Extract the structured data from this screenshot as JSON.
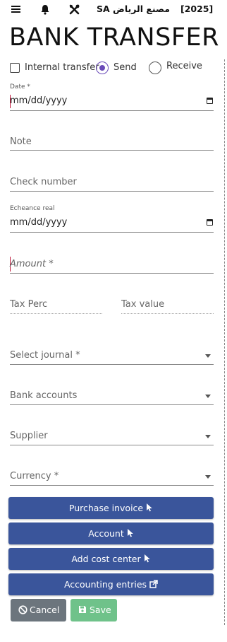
{
  "header": {
    "company": "مصنع الرياض SA",
    "year": "[2025]"
  },
  "title": "BANK TRANSFER",
  "transfer_options": {
    "internal": "Internal transfer",
    "send": "Send",
    "receive": "Receive",
    "selected": "Send"
  },
  "form": {
    "date": {
      "label": "Date *",
      "value": "mm/dd/yyyy"
    },
    "note": {
      "placeholder": "Note"
    },
    "check_number": {
      "placeholder": "Check number"
    },
    "echeance": {
      "label": "Echeance real",
      "value": "mm/dd/yyyy"
    },
    "amount": {
      "placeholder": "Amount *"
    },
    "tax_perc": {
      "placeholder": "Tax Perc"
    },
    "tax_value": {
      "placeholder": "Tax value"
    },
    "journal": {
      "placeholder": "Select journal  *"
    },
    "bank_accounts": {
      "placeholder": "Bank accounts"
    },
    "supplier": {
      "placeholder": "Supplier"
    },
    "currency": {
      "placeholder": "Currency  *"
    }
  },
  "buttons": {
    "purchase_invoice": "Purchase invoice",
    "account": "Account",
    "cost_center": "Add cost center",
    "accounting_entries": "Accounting entries",
    "cancel": "Cancel",
    "save": "Save"
  },
  "colors": {
    "primary_button": "#3a559b",
    "cancel_button": "#6c757d",
    "save_button": "#6fc28a",
    "radio_accent": "#6a4bb8",
    "required_marker": "#c0163b"
  },
  "icons": [
    "menu-icon",
    "bell-icon",
    "tools-icon",
    "calendar-icon",
    "chevron-down-icon",
    "pointer-icon",
    "external-link-icon",
    "ban-icon",
    "save-icon"
  ]
}
